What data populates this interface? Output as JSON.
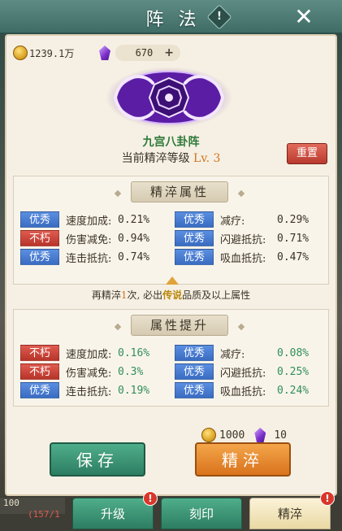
{
  "header": {
    "title": "阵法",
    "info_icon": "info-icon",
    "close_icon": "close-icon"
  },
  "resources": {
    "gold": "1239.1万",
    "gems": "670",
    "plus": "+"
  },
  "formation": {
    "name": "九宫八卦阵",
    "level_label": "当前精淬等级",
    "level_value": "Lv. 3",
    "reset_label": "重置"
  },
  "current_attrs": {
    "title": "精淬属性",
    "left": [
      {
        "quality": "优秀",
        "tag_color": "blue",
        "label": "速度加成:",
        "value": "0.21%"
      },
      {
        "quality": "不朽",
        "tag_color": "red",
        "label": "伤害减免:",
        "value": "0.94%"
      },
      {
        "quality": "优秀",
        "tag_color": "blue",
        "label": "连击抵抗:",
        "value": "0.74%"
      }
    ],
    "right": [
      {
        "quality": "优秀",
        "tag_color": "blue",
        "label": "减疗:",
        "value": "0.29%"
      },
      {
        "quality": "优秀",
        "tag_color": "blue",
        "label": "闪避抵抗:",
        "value": "0.71%"
      },
      {
        "quality": "优秀",
        "tag_color": "blue",
        "label": "吸血抵抗:",
        "value": "0.47%"
      }
    ]
  },
  "hint": {
    "pre": "再精淬",
    "count": "1",
    "mid": "次, 必出",
    "quality": "传说",
    "post": "品质及以上属性"
  },
  "upgrade_attrs": {
    "title": "属性提升",
    "left": [
      {
        "quality": "不朽",
        "tag_color": "red",
        "label": "速度加成:",
        "value": "0.16%"
      },
      {
        "quality": "不朽",
        "tag_color": "red",
        "label": "伤害减免:",
        "value": "0.3%"
      },
      {
        "quality": "优秀",
        "tag_color": "blue",
        "label": "连击抵抗:",
        "value": "0.19%"
      }
    ],
    "right": [
      {
        "quality": "优秀",
        "tag_color": "blue",
        "label": "减疗:",
        "value": "0.08%"
      },
      {
        "quality": "优秀",
        "tag_color": "blue",
        "label": "闪避抵抗:",
        "value": "0.25%"
      },
      {
        "quality": "优秀",
        "tag_color": "blue",
        "label": "吸血抵抗:",
        "value": "0.24%"
      }
    ]
  },
  "cost": {
    "gold": "1000",
    "gems": "10"
  },
  "actions": {
    "save": "保存",
    "refine": "精淬"
  },
  "tabs": {
    "upgrade": "升级",
    "seal": "刻印",
    "refine": "精淬",
    "badge": "!"
  },
  "background_hud": {
    "level": "100",
    "hp": "(157/1"
  },
  "colors": {
    "blue_tag": "#3a6cc2",
    "red_tag": "#b7342a",
    "green_value": "#2f8f5a",
    "accent_orange": "#d2731b",
    "formation_purple": "#7a2fc9"
  }
}
